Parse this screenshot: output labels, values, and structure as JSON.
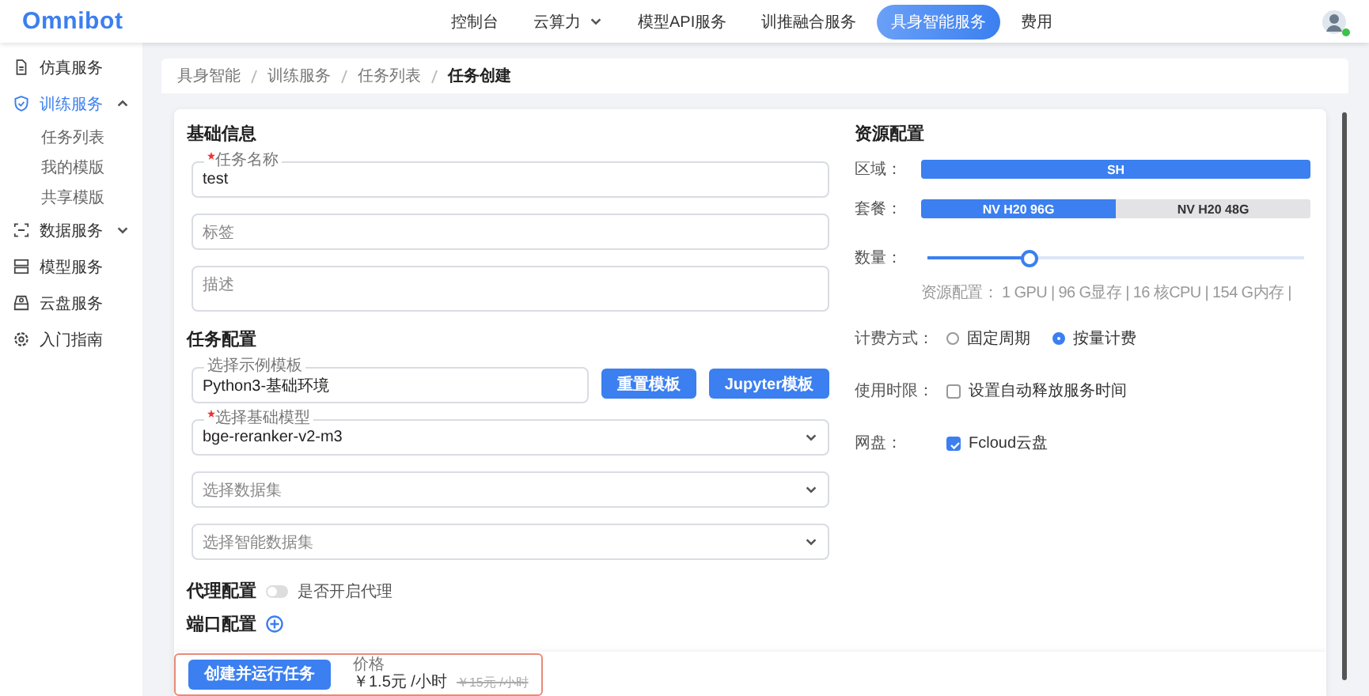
{
  "header": {
    "logo": "Omnibot",
    "nav": [
      {
        "label": "控制台",
        "selected": false,
        "has_menu": false
      },
      {
        "label": "云算力",
        "selected": false,
        "has_menu": true
      },
      {
        "label": "模型API服务",
        "selected": false,
        "has_menu": false
      },
      {
        "label": "训推融合服务",
        "selected": false,
        "has_menu": false
      },
      {
        "label": "具身智能服务",
        "selected": true,
        "has_menu": false
      },
      {
        "label": "费用",
        "selected": false,
        "has_menu": false
      }
    ]
  },
  "sidebar": {
    "items": [
      {
        "label": "仿真服务",
        "selected": false
      },
      {
        "label": "训练服务",
        "selected": true,
        "expanded": true,
        "children": [
          {
            "label": "任务列表"
          },
          {
            "label": "我的模版"
          },
          {
            "label": "共享模版"
          }
        ]
      },
      {
        "label": "数据服务",
        "selected": false,
        "expanded": false
      },
      {
        "label": "模型服务",
        "selected": false
      },
      {
        "label": "云盘服务",
        "selected": false
      },
      {
        "label": "入门指南",
        "selected": false
      }
    ]
  },
  "breadcrumb": [
    "具身智能",
    "训练服务",
    "任务列表",
    "任务创建"
  ],
  "basic_info": {
    "title": "基础信息",
    "fields": [
      {
        "kind": "input",
        "label": "任务名称",
        "value": "test",
        "required": true
      },
      {
        "kind": "input",
        "placeholder": "标签",
        "required": false
      },
      {
        "kind": "textarea",
        "placeholder": "描述",
        "required": false
      }
    ]
  },
  "task_config": {
    "title": "任务配置",
    "template": {
      "label": "选择示例模板",
      "value": "Python3-基础环境"
    },
    "buttons": [
      "重置模板",
      "Jupyter模板"
    ],
    "selects": [
      {
        "label": "选择基础模型",
        "value": "bge-reranker-v2-m3",
        "required": true
      },
      {
        "placeholder": "选择数据集",
        "required": false
      },
      {
        "placeholder": "选择智能数据集",
        "required": false
      }
    ]
  },
  "proxy": {
    "title": "代理配置",
    "toggle_label": "是否开启代理",
    "on": false
  },
  "ports": {
    "title": "端口配置"
  },
  "resources": {
    "title": "资源配置",
    "region": {
      "label": "区域：",
      "options": [
        {
          "label": "SH",
          "selected": true
        }
      ]
    },
    "package": {
      "label": "套餐：",
      "options": [
        {
          "label": "NV H20 96G",
          "selected": true
        },
        {
          "label": "NV H20 48G",
          "selected": false
        }
      ]
    },
    "quantity": {
      "label": "数量：",
      "level": 0.26,
      "note": "资源配置：  1 GPU | 96 G显存 | 16 核CPU | 154 G内存 |"
    },
    "billing": {
      "label": "计费方式：",
      "options": [
        {
          "label": "固定周期",
          "selected": false
        },
        {
          "label": "按量计费",
          "selected": true
        }
      ]
    },
    "time_limit": {
      "label": "使用时限：",
      "option": "设置自动释放服务时间",
      "checked": false
    },
    "disk": {
      "label": "网盘：",
      "option": "Fcloud云盘",
      "checked": true
    }
  },
  "footer": {
    "button": "创建并运行任务",
    "price_label": "价格",
    "price": "￥1.5元 /小时",
    "original_price": "￥15元 /小时"
  }
}
